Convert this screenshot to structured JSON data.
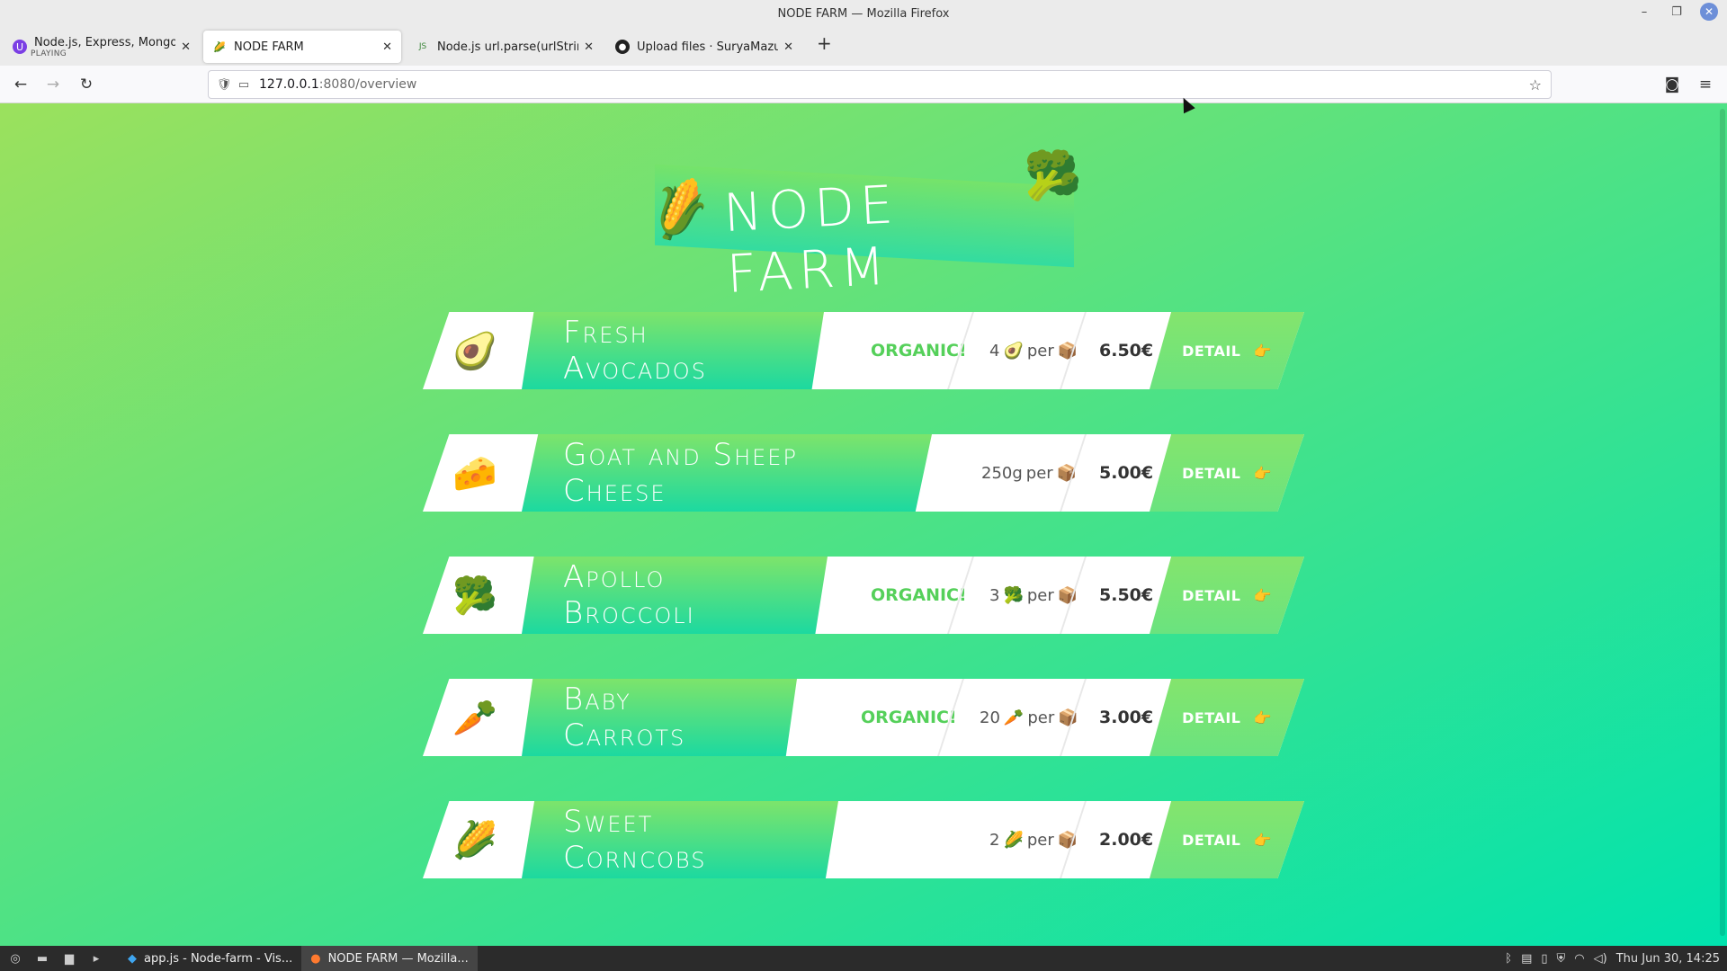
{
  "window": {
    "title": "NODE FARM — Mozilla Firefox",
    "controls": [
      "minimize-icon",
      "restore-icon",
      "close-icon"
    ]
  },
  "tabs": [
    {
      "title": "Node.js, Express, MongoDB",
      "subtitle": "PLAYING",
      "icon": "podcast-icon",
      "active": false
    },
    {
      "title": "NODE FARM",
      "icon": "corn-icon",
      "active": true
    },
    {
      "title": "Node.js url.parse(urlString, p",
      "icon": "node-icon",
      "active": false
    },
    {
      "title": "Upload files · SuryaMazumd",
      "icon": "github-icon",
      "active": false
    }
  ],
  "url": {
    "host": "127.0.0.1",
    "rest": ":8080/overview"
  },
  "page": {
    "logo": "NODE FARM",
    "logo_left_emoji": "🌽",
    "logo_right_emoji": "🥦",
    "detail_label": "DETAIL",
    "detail_emoji": "👉",
    "per_label": "per",
    "box_emoji": "📦"
  },
  "products": [
    {
      "image": "🥑",
      "name": "Fresh Avocados",
      "organic": "ORGANIC!",
      "qty": "4",
      "qty_emoji": "🥑",
      "price": "6.50€"
    },
    {
      "image": "🧀",
      "name": "Goat and Sheep Cheese",
      "organic": "",
      "qty": "250g",
      "qty_emoji": "",
      "price": "5.00€"
    },
    {
      "image": "🥦",
      "name": "Apollo Broccoli",
      "organic": "ORGANIC!",
      "qty": "3",
      "qty_emoji": "🥦",
      "price": "5.50€"
    },
    {
      "image": "🥕",
      "name": "Baby Carrots",
      "organic": "ORGANIC!",
      "qty": "20",
      "qty_emoji": "🥕",
      "price": "3.00€"
    },
    {
      "image": "🌽",
      "name": "Sweet Corncobs",
      "organic": "",
      "qty": "2",
      "qty_emoji": "🌽",
      "price": "2.00€"
    }
  ],
  "taskbar": {
    "tasks": [
      {
        "label": "app.js - Node-farm - Vis...",
        "icon": "vscode-icon",
        "active": false
      },
      {
        "label": "NODE FARM — Mozilla...",
        "icon": "firefox-icon",
        "active": true
      }
    ],
    "clock": "Thu Jun 30, 14:25"
  }
}
